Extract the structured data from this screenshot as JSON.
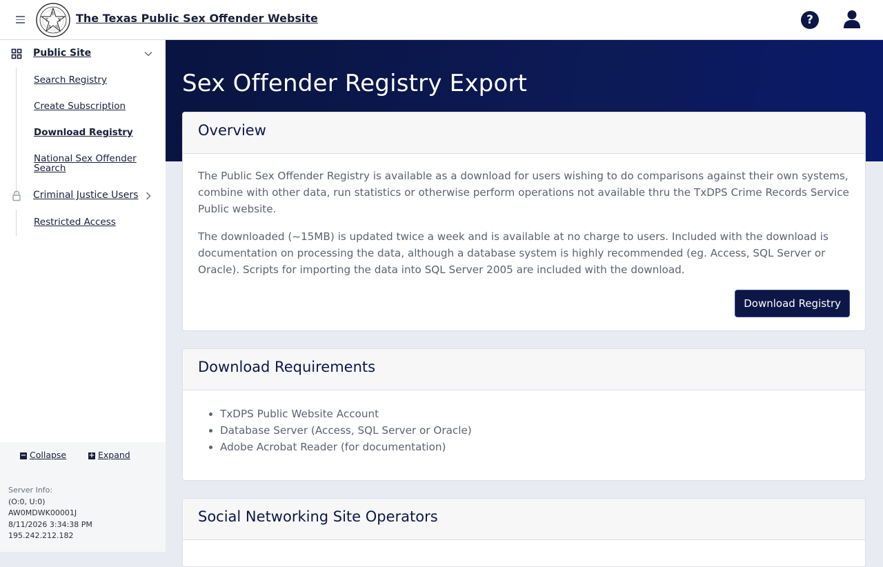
{
  "header": {
    "site_title": "The Texas Public Sex Offender Website",
    "seal_text": "TEXAS"
  },
  "sidebar": {
    "section_public": "Public Site",
    "items": [
      "Search Registry",
      "Create Subscription",
      "Download Registry",
      "National Sex Offender Search"
    ],
    "active_item": "Download Registry",
    "section_cj": "Criminal Justice Users",
    "cj_items": [
      "Restricted Access"
    ],
    "collapse_label": "Collapse",
    "expand_label": "Expand",
    "server_info": {
      "heading": "Server Info:",
      "line1": "(O:0, U:0)",
      "line2": "AW0MDWK00001J",
      "line3": "8/11/2026 3:34:38 PM",
      "line4": "195.242.212.182"
    }
  },
  "main": {
    "page_title": "Sex Offender Registry Export",
    "overview": {
      "heading": "Overview",
      "para1": "The Public Sex Offender Registry is available as a download for users wishing to do comparisons against their own systems, combine with other data, run statistics or otherwise perform operations not available thru the TxDPS Crime Records Service Public website.",
      "para2": "The downloaded (~15MB) is updated twice a week and is available at no charge to users. Included with the download is documentation on processing the data, although a database system is highly recommended (eg. Access, SQL Server or Oracle). Scripts for importing the data into SQL Server 2005 are included with the download.",
      "button": "Download Registry"
    },
    "requirements": {
      "heading": "Download Requirements",
      "items": [
        "TxDPS Public Website Account",
        "Database Server (Access, SQL Server or Oracle)",
        "Adobe Acrobat Reader (for documentation)"
      ]
    },
    "social": {
      "heading": "Social Networking Site Operators"
    }
  },
  "colors": {
    "brand_navy": "#0c1747",
    "hero_bg": "#0c1a56"
  }
}
